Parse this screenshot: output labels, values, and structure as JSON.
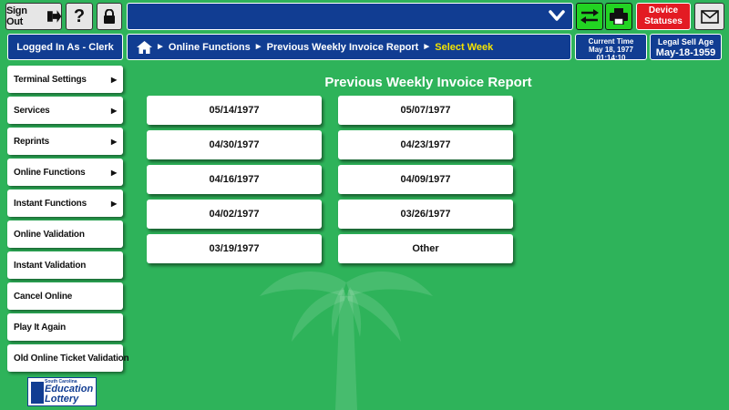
{
  "header": {
    "sign_out_label": "Sign Out",
    "help_label": "?",
    "device_statuses_line1": "Device",
    "device_statuses_line2": "Statuses"
  },
  "user": {
    "logged_in_label": "Logged In As - Clerk"
  },
  "breadcrumb": {
    "home_icon": "home-icon",
    "items": [
      "Online Functions",
      "Previous Weekly Invoice Report"
    ],
    "current": "Select Week"
  },
  "current_time": {
    "label": "Current Time",
    "date": "May 18, 1977",
    "time": "01:14:10"
  },
  "legal_sell_age": {
    "label": "Legal Sell Age",
    "value": "May-18-1959"
  },
  "sidebar": {
    "items": [
      {
        "label": "Terminal Settings",
        "has_submenu": true
      },
      {
        "label": "Services",
        "has_submenu": true
      },
      {
        "label": "Reprints",
        "has_submenu": true
      },
      {
        "label": "Online Functions",
        "has_submenu": true
      },
      {
        "label": "Instant Functions",
        "has_submenu": true
      },
      {
        "label": "Online Validation",
        "has_submenu": false
      },
      {
        "label": "Instant Validation",
        "has_submenu": false
      },
      {
        "label": "Cancel Online",
        "has_submenu": false
      },
      {
        "label": "Play It Again",
        "has_submenu": false
      },
      {
        "label": "Old Online Ticket Validation",
        "has_submenu": false
      }
    ]
  },
  "report": {
    "title": "Previous Weekly Invoice Report",
    "weeks": [
      "05/14/1977",
      "05/07/1977",
      "04/30/1977",
      "04/23/1977",
      "04/16/1977",
      "04/09/1977",
      "04/02/1977",
      "03/26/1977",
      "03/19/1977",
      "Other"
    ]
  },
  "logo": {
    "line1": "South Carolina",
    "line2": "Education",
    "line3": "Lottery"
  },
  "colors": {
    "background": "#2eb35a",
    "navy": "#113d92",
    "accent_yellow": "#f5e400",
    "alert_red": "#e31b23",
    "action_green": "#22d422"
  }
}
